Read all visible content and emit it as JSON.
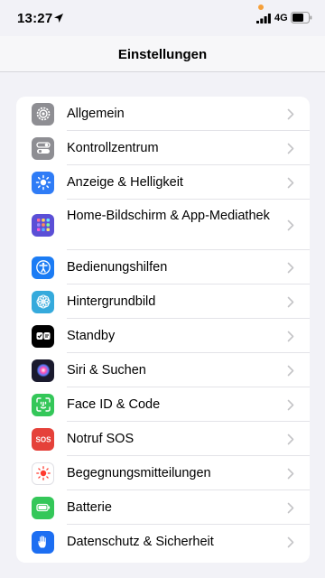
{
  "status_bar": {
    "time": "13:27",
    "network": "4G"
  },
  "nav": {
    "title": "Einstellungen"
  },
  "settings": [
    {
      "label": "Allgemein",
      "icon": "gear-icon",
      "color": "#8e8e93"
    },
    {
      "label": "Kontrollzentrum",
      "icon": "toggles-icon",
      "color": "#8e8e93"
    },
    {
      "label": "Anzeige & Helligkeit",
      "icon": "sun-icon",
      "color": "#2f7cf6"
    },
    {
      "label": "Home-Bildschirm & App-Mediathek",
      "icon": "app-grid-icon",
      "color": "#5b4fd6"
    },
    {
      "label": "Bedienungshilfen",
      "icon": "accessibility-icon",
      "color": "#1c7cf4"
    },
    {
      "label": "Hintergrundbild",
      "icon": "flower-icon",
      "color": "#35aadc"
    },
    {
      "label": "Standby",
      "icon": "standby-icon",
      "color": "#000000"
    },
    {
      "label": "Siri & Suchen",
      "icon": "siri-icon",
      "color": "#1a1a2e"
    },
    {
      "label": "Face ID & Code",
      "icon": "face-id-icon",
      "color": "#34c759"
    },
    {
      "label": "Notruf SOS",
      "icon": "sos-icon",
      "color": "#e5413a"
    },
    {
      "label": "Begegnungsmitteilungen",
      "icon": "exposure-icon",
      "color": "#ffffff"
    },
    {
      "label": "Batterie",
      "icon": "battery-icon",
      "color": "#34c759"
    },
    {
      "label": "Datenschutz & Sicherheit",
      "icon": "hand-icon",
      "color": "#1c6ef2"
    }
  ]
}
